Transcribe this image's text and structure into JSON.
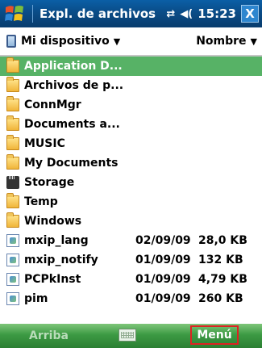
{
  "titlebar": {
    "title": "Expl. de archivos",
    "time": "15:23",
    "close_glyph": "X",
    "connectivity_icon": "⇄",
    "volume_icon": "◀("
  },
  "header": {
    "location": "Mi dispositivo",
    "sort": "Nombre"
  },
  "files": [
    {
      "name": "Application D...",
      "date": "",
      "size": "",
      "type": "folder",
      "selected": true
    },
    {
      "name": "Archivos de p...",
      "date": "",
      "size": "",
      "type": "folder"
    },
    {
      "name": "ConnMgr",
      "date": "",
      "size": "",
      "type": "folder"
    },
    {
      "name": "Documents a...",
      "date": "",
      "size": "",
      "type": "folder"
    },
    {
      "name": "MUSIC",
      "date": "",
      "size": "",
      "type": "folder"
    },
    {
      "name": "My Documents",
      "date": "",
      "size": "",
      "type": "folder"
    },
    {
      "name": "Storage",
      "date": "",
      "size": "",
      "type": "storage-card"
    },
    {
      "name": "Temp",
      "date": "",
      "size": "",
      "type": "folder"
    },
    {
      "name": "Windows",
      "date": "",
      "size": "",
      "type": "folder"
    },
    {
      "name": "mxip_lang",
      "date": "02/09/09",
      "size": "28,0 KB",
      "type": "file"
    },
    {
      "name": "mxip_notify",
      "date": "01/09/09",
      "size": "132 KB",
      "type": "file"
    },
    {
      "name": "PCPkInst",
      "date": "01/09/09",
      "size": "4,79 KB",
      "type": "file"
    },
    {
      "name": "pim",
      "date": "01/09/09",
      "size": "260 KB",
      "type": "file"
    }
  ],
  "softkeys": {
    "left": "Arriba",
    "right": "Menú"
  },
  "colors": {
    "titlebar": "#0a4c87",
    "selection": "#57b266",
    "softkey_bar": "#3c9a43",
    "highlight_box": "#dd2222"
  }
}
